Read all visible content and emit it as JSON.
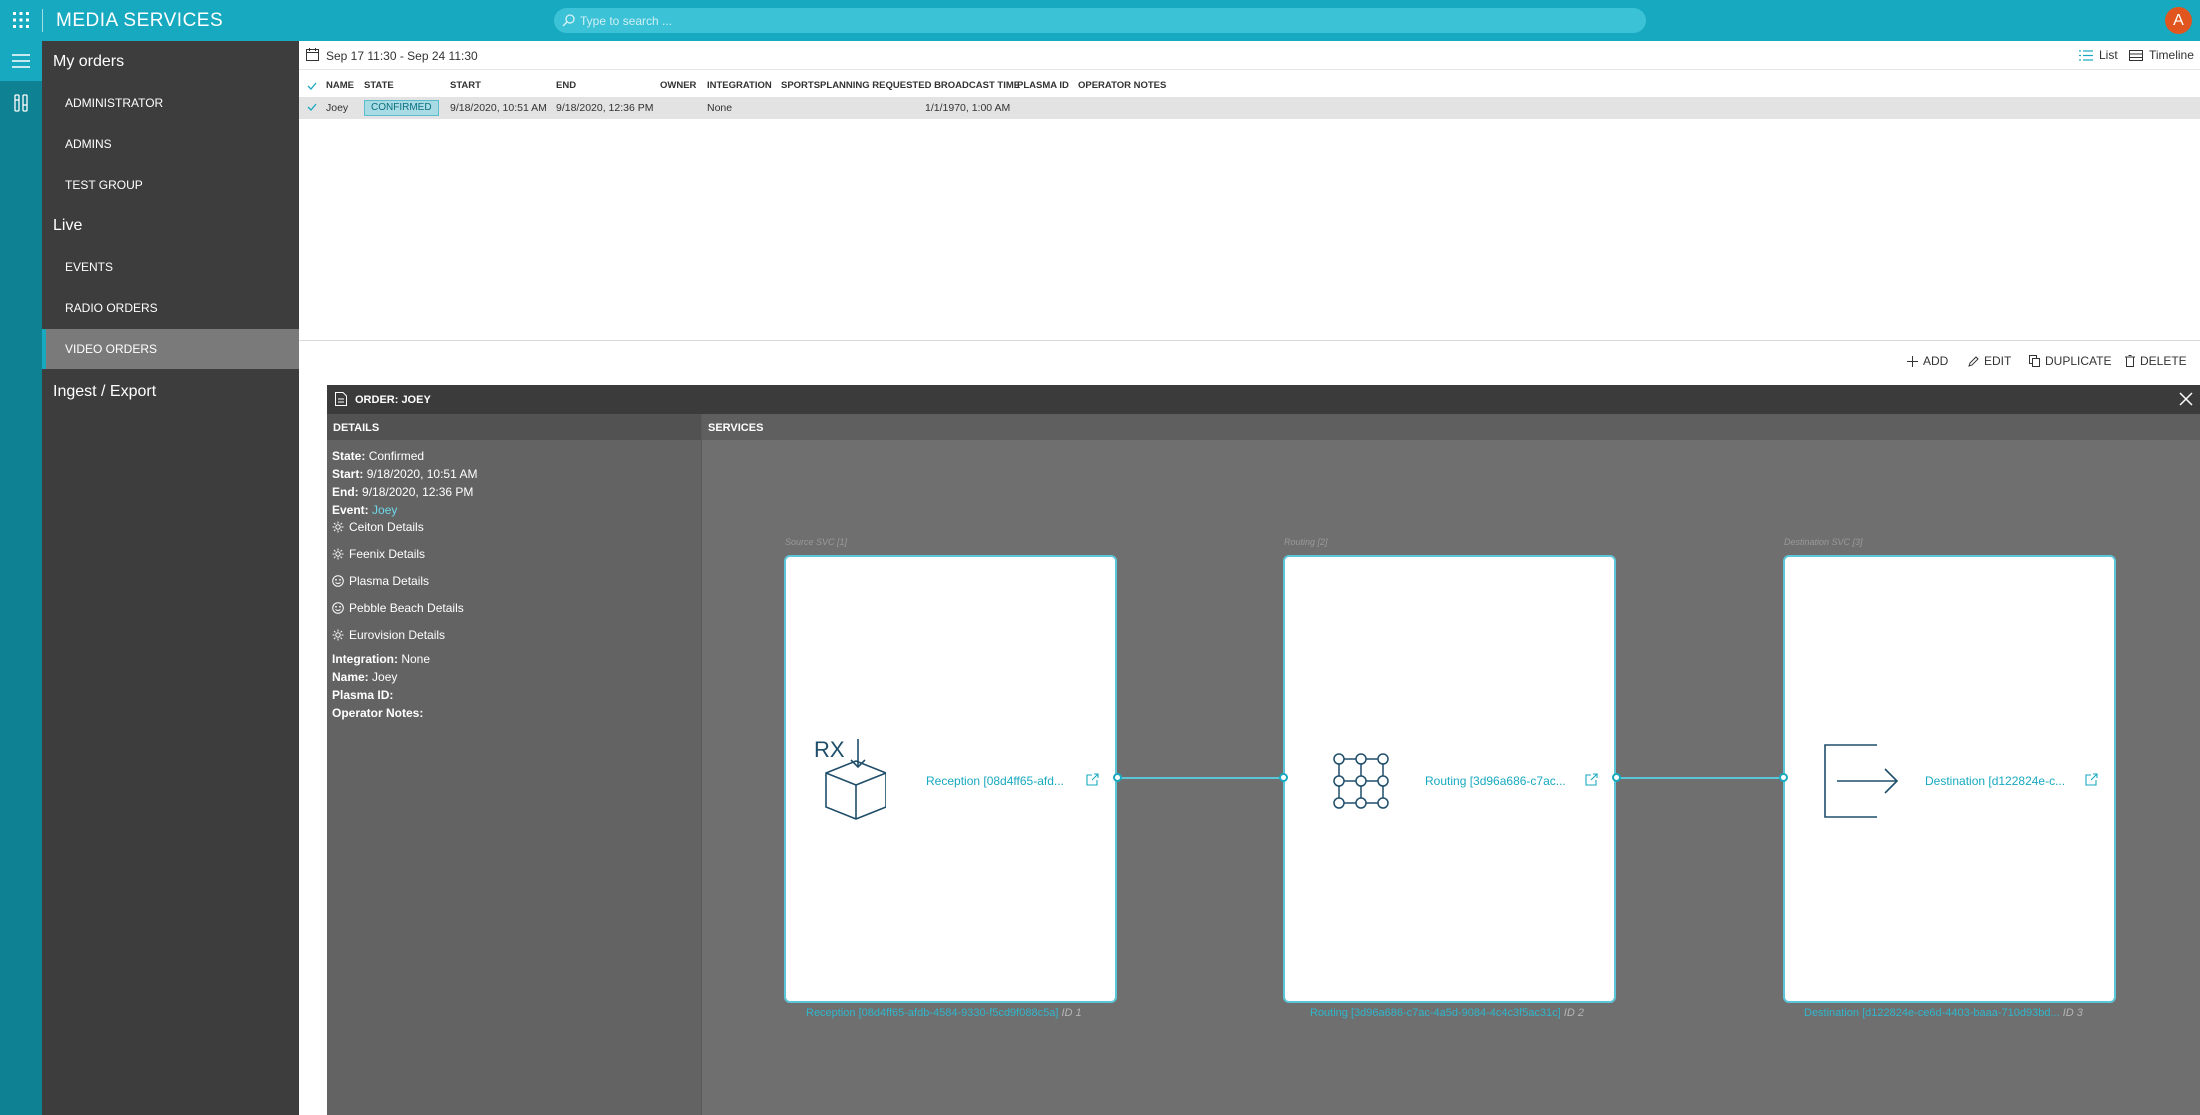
{
  "app": {
    "title": "MEDIA SERVICES",
    "avatar_initial": "A"
  },
  "search": {
    "placeholder": "Type to search ..."
  },
  "sidebar": {
    "sections": [
      {
        "label": "My orders",
        "items": [
          "ADMINISTRATOR",
          "ADMINS",
          "TEST GROUP"
        ]
      },
      {
        "label": "Live",
        "items": [
          "EVENTS",
          "RADIO ORDERS",
          "VIDEO ORDERS"
        ]
      },
      {
        "label": "Ingest / Export",
        "items": []
      }
    ],
    "active_item": "VIDEO ORDERS"
  },
  "toolbar": {
    "date_range": "Sep 17 11:30 - Sep 24 11:30",
    "list_label": "List",
    "timeline_label": "Timeline"
  },
  "table": {
    "columns": [
      "NAME",
      "STATE",
      "START",
      "END",
      "OWNER",
      "INTEGRATION",
      "SPORTSPLANNING REQUESTED BROADCAST TIME",
      "PLASMA ID",
      "OPERATOR NOTES"
    ],
    "rows": [
      {
        "name": "Joey",
        "state": "CONFIRMED",
        "start": "9/18/2020, 10:51 AM",
        "end": "9/18/2020, 12:36 PM",
        "owner": "",
        "integration": "None",
        "broadcast_time": "1/1/1970, 1:00 AM",
        "plasma_id": "",
        "operator_notes": ""
      }
    ]
  },
  "actions": {
    "add": "ADD",
    "edit": "EDIT",
    "duplicate": "DUPLICATE",
    "delete": "DELETE"
  },
  "order": {
    "title": "ORDER: JOEY",
    "details_heading": "DETAILS",
    "services_heading": "SERVICES",
    "state_label": "State:",
    "state_value": "Confirmed",
    "start_label": "Start:",
    "start_value": "9/18/2020, 10:51 AM",
    "end_label": "End:",
    "end_value": "9/18/2020, 12:36 PM",
    "event_label": "Event:",
    "event_value": "Joey",
    "links": [
      "Ceiton Details",
      "Feenix Details",
      "Plasma Details",
      "Pebble Beach Details",
      "Eurovision Details"
    ],
    "integration_label": "Integration:",
    "integration_value": "None",
    "name_label": "Name:",
    "name_value": "Joey",
    "plasma_label": "Plasma ID:",
    "notes_label": "Operator Notes:"
  },
  "services": [
    {
      "caption": "Source SVC [1]",
      "link": "Reception [08d4ff65-afd...",
      "footer": "Reception [08d4ff65-afdb-4584-9330-f5cd9f088c5a]",
      "id": "ID 1",
      "icon": "reception-rx-icon"
    },
    {
      "caption": "Routing [2]",
      "link": "Routing [3d96a686-c7ac...",
      "footer": "Routing [3d96a686-c7ac-4a5d-9084-4c4c3f5ac31c]",
      "id": "ID 2",
      "icon": "routing-matrix-icon"
    },
    {
      "caption": "Destination SVC [3]",
      "link": "Destination [d122824e-c...",
      "footer": "Destination [d122824e-ce6d-4403-baaa-710d93bd...",
      "id": "ID 3",
      "icon": "destination-exit-icon"
    }
  ],
  "colors": {
    "accent": "#17a9bf",
    "rail": "#0e8192",
    "sidebar": "#3d3d3d",
    "panel": "#6f6f6f",
    "avatar": "#e0561e"
  }
}
